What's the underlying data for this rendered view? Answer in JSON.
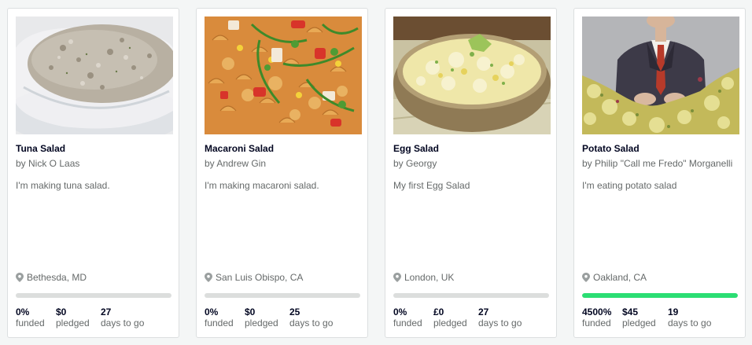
{
  "accent_color": "#2bde73",
  "projects": [
    {
      "image_desc": "tuna salad in glass bowl",
      "title": "Tuna Salad",
      "author": "by Nick O Laas",
      "description": "I'm making tuna salad.",
      "location": "Bethesda, MD",
      "location_icon": "map-pin-icon",
      "progress_fraction": 0,
      "funded_value": "0%",
      "funded_label": "funded",
      "pledged_value": "$0",
      "pledged_label": "pledged",
      "days_value": "27",
      "days_label": "days to go"
    },
    {
      "image_desc": "macaroni salad with arugula and tomatoes",
      "title": "Macaroni Salad",
      "author": "by Andrew Gin",
      "description": "I'm making macaroni salad.",
      "location": "San Luis Obispo, CA",
      "location_icon": "map-pin-icon",
      "progress_fraction": 0,
      "funded_value": "0%",
      "funded_label": "funded",
      "pledged_value": "$0",
      "pledged_label": "pledged",
      "days_value": "25",
      "days_label": "days to go"
    },
    {
      "image_desc": "egg salad in a bowl",
      "title": "Egg Salad",
      "author": "by Georgy",
      "description": "My first Egg Salad",
      "location": "London, UK",
      "location_icon": "map-pin-icon",
      "progress_fraction": 0,
      "funded_value": "0%",
      "funded_label": "funded",
      "pledged_value": "£0",
      "pledged_label": "pledged",
      "days_value": "27",
      "days_label": "days to go"
    },
    {
      "image_desc": "man in suit behind potato salad",
      "title": "Potato Salad",
      "author": "by Philip \"Call me Fredo\" Morganelli",
      "description": "I'm eating potato salad",
      "location": "Oakland, CA",
      "location_icon": "map-pin-icon",
      "progress_fraction": 1,
      "funded_value": "4500%",
      "funded_label": "funded",
      "pledged_value": "$45",
      "pledged_label": "pledged",
      "days_value": "19",
      "days_label": "days to go"
    }
  ]
}
